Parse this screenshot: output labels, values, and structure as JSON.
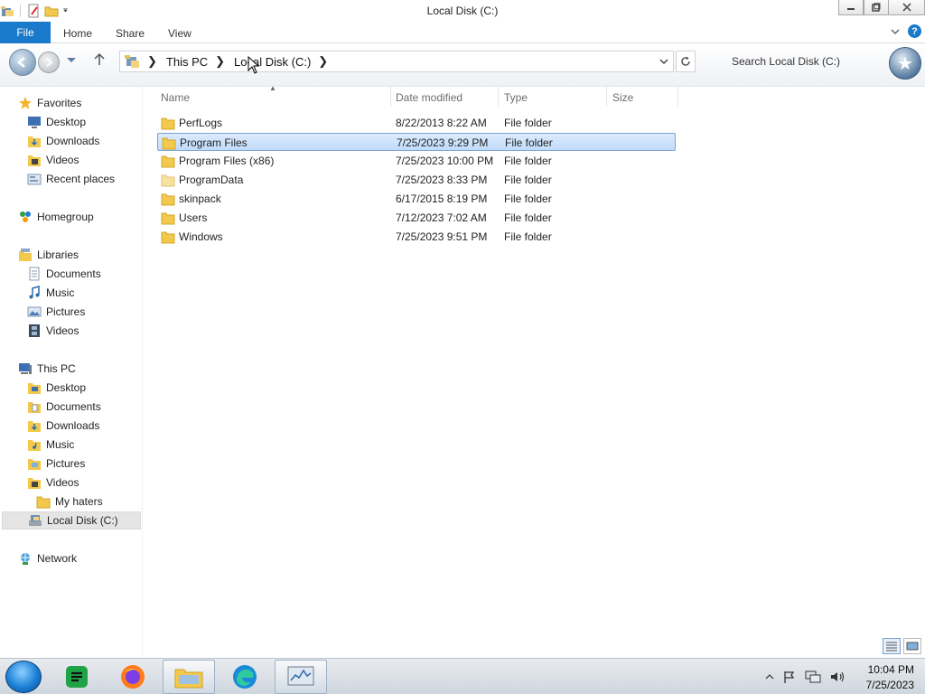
{
  "window": {
    "title": "Local Disk (C:)",
    "accent": "#1979ca"
  },
  "ribbon": {
    "file_tab": "File",
    "tabs": [
      "Home",
      "Share",
      "View"
    ]
  },
  "address": {
    "breadcrumbs": [
      "This PC",
      "Local Disk (C:)"
    ],
    "search_placeholder": "Search Local Disk (C:)"
  },
  "sidebar": {
    "favorites": {
      "label": "Favorites",
      "items": [
        "Desktop",
        "Downloads",
        "Videos",
        "Recent places"
      ]
    },
    "homegroup": "Homegroup",
    "libraries": {
      "label": "Libraries",
      "items": [
        "Documents",
        "Music",
        "Pictures",
        "Videos"
      ]
    },
    "this_pc": {
      "label": "This PC",
      "items": [
        "Desktop",
        "Documents",
        "Downloads",
        "Music",
        "Pictures",
        "Videos",
        "My haters",
        "Local Disk (C:)"
      ]
    },
    "network": "Network"
  },
  "columns": [
    "Name",
    "Date modified",
    "Type",
    "Size"
  ],
  "files": [
    {
      "name": "PerfLogs",
      "date": "8/22/2013 8:22 AM",
      "type": "File folder"
    },
    {
      "name": "Program Files",
      "date": "7/25/2023 9:29 PM",
      "type": "File folder",
      "selected": true
    },
    {
      "name": "Program Files (x86)",
      "date": "7/25/2023 10:00 PM",
      "type": "File folder"
    },
    {
      "name": "ProgramData",
      "date": "7/25/2023 8:33 PM",
      "type": "File folder"
    },
    {
      "name": "skinpack",
      "date": "6/17/2015 8:19 PM",
      "type": "File folder"
    },
    {
      "name": "Users",
      "date": "7/12/2023 7:02 AM",
      "type": "File folder"
    },
    {
      "name": "Windows",
      "date": "7/25/2023 9:51 PM",
      "type": "File folder"
    }
  ],
  "taskbar": {
    "apps": [
      "start-orb",
      "sheets",
      "firefox",
      "file-explorer",
      "edge",
      "task-manager"
    ],
    "clock_time": "10:04 PM",
    "clock_date": "7/25/2023"
  }
}
